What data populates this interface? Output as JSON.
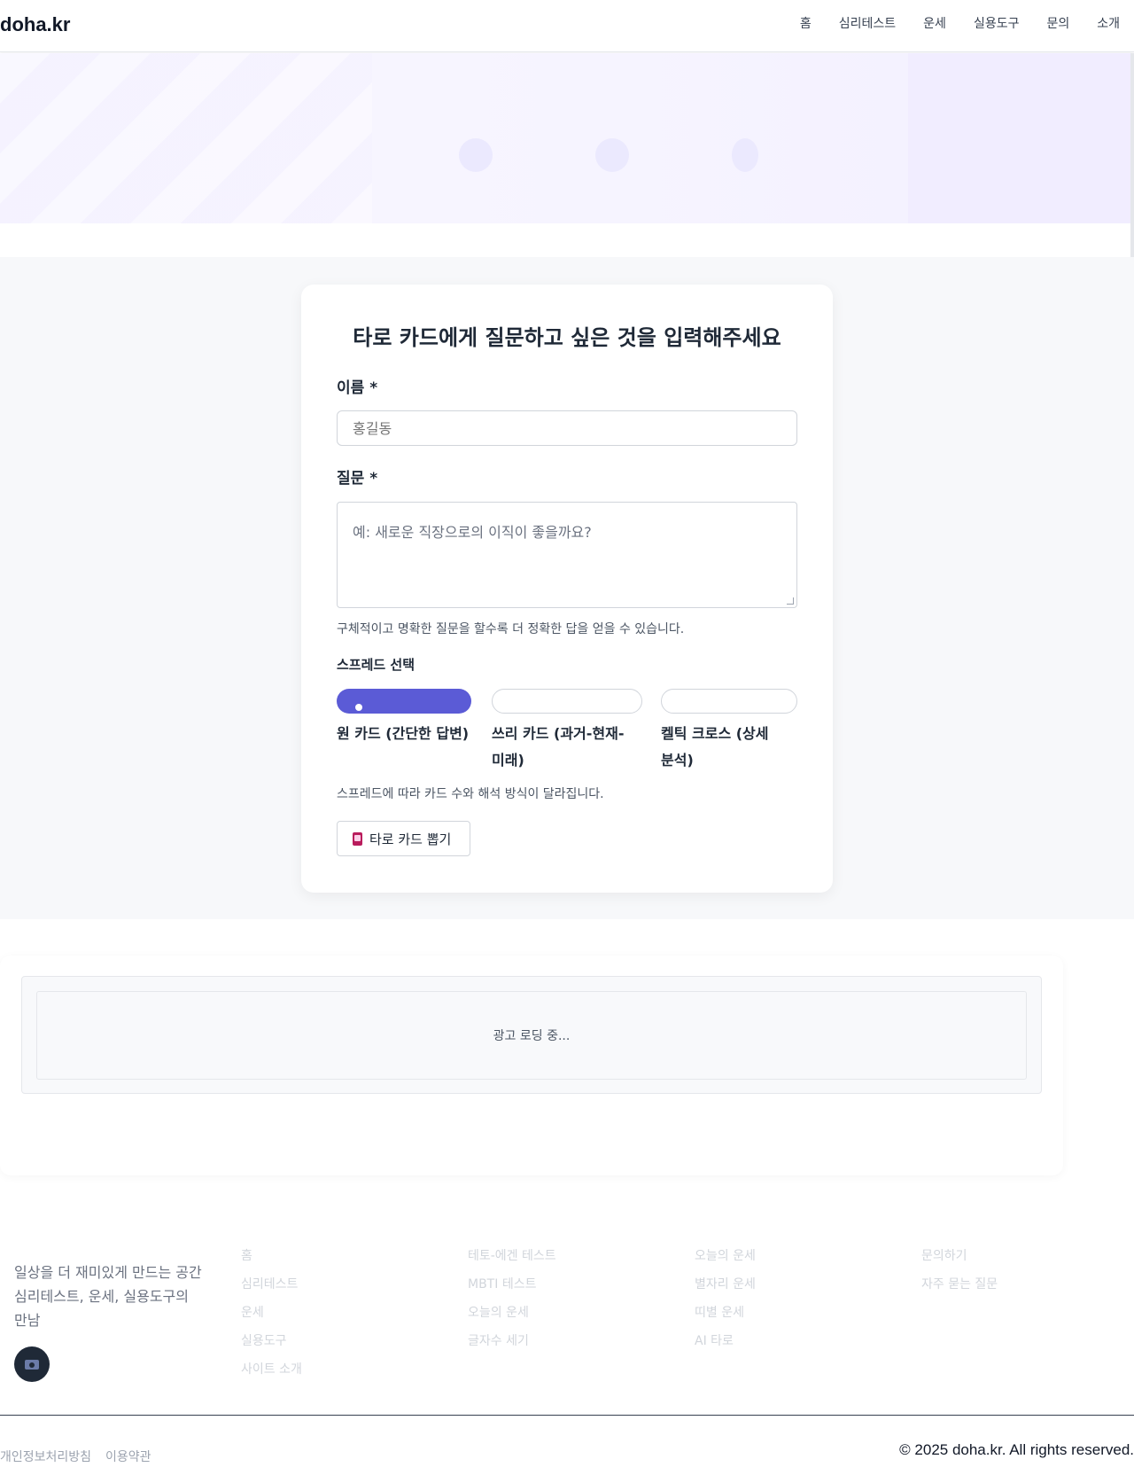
{
  "site": {
    "logo": "doha.kr"
  },
  "nav": [
    "홈",
    "심리테스트",
    "운세",
    "실용도구",
    "문의",
    "소개"
  ],
  "form": {
    "title": "타로 카드에게 질문하고 싶은 것을 입력해주세요",
    "name_label": "이름 *",
    "name_placeholder": "홍길동",
    "question_label": "질문 *",
    "question_placeholder": "예: 새로운 직장으로의 이직이 좋을까요?",
    "question_hint": "구체적이고 명확한 질문을 할수록 더 정확한 답을 얻을 수 있습니다.",
    "spread_title": "스프레드 선택",
    "spreads": [
      {
        "line1": "원 카드 (간단한 답변)",
        "line2": "",
        "selected": true
      },
      {
        "line1": "쓰리 카드 (과거-현재-",
        "line2": "미래)",
        "selected": false
      },
      {
        "line1": "켈틱 크로스 (상세",
        "line2": "분석)",
        "selected": false
      }
    ],
    "spread_hint": "스프레드에 따라 카드 수와 해석 방식이 달라집니다.",
    "draw_button": "타로 카드 뽑기"
  },
  "ad": {
    "loading": "광고 로딩 중..."
  },
  "footer": {
    "tagline_line1": "일상을 더 재미있게 만드는 공간",
    "tagline_line2": "심리테스트, 운세, 실용도구의",
    "tagline_line3": "만남",
    "col1": [
      "홈",
      "심리테스트",
      "운세",
      "실용도구",
      "사이트 소개"
    ],
    "col2": [
      "테토-에겐 테스트",
      "MBTI 테스트",
      "오늘의 운세",
      "글자수 세기"
    ],
    "col3": [
      "오늘의 운세",
      "별자리 운세",
      "띠별 운세",
      "AI 타로"
    ],
    "col4": [
      "문의하기",
      "자주 묻는 질문"
    ],
    "bottom_links": [
      "개인정보처리방침",
      "이용약관"
    ],
    "copyright": "© 2025 doha.kr. All rights reserved."
  },
  "colors": {
    "accent": "#5b5bd6",
    "hero_bg": "#f6f4ff",
    "band_bg": "#f7f8fa"
  }
}
